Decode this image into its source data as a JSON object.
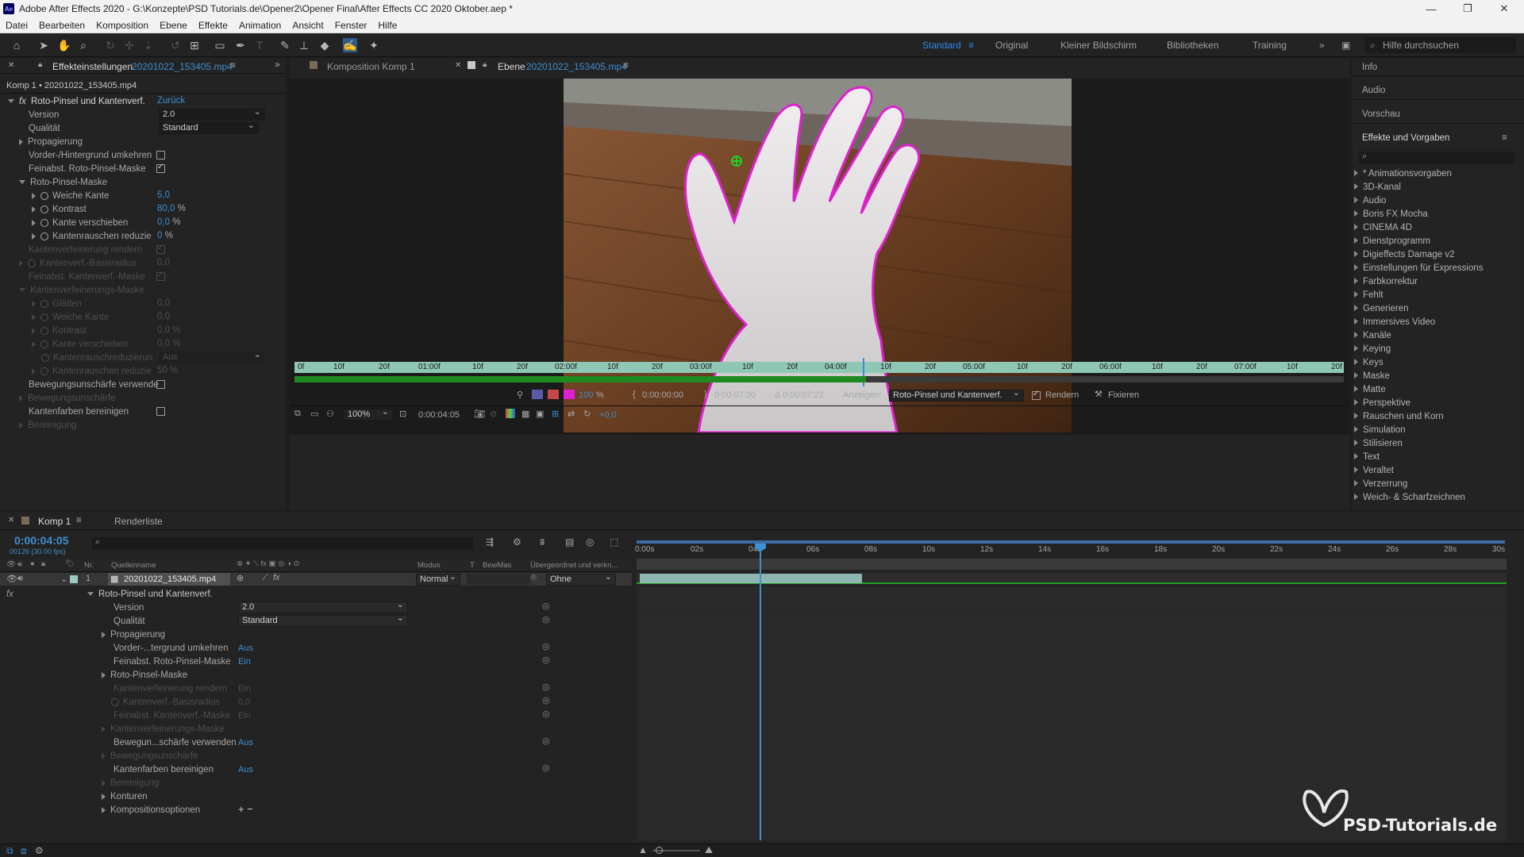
{
  "window": {
    "title": "Adobe After Effects 2020 - G:\\Konzepte\\PSD Tutorials.de\\Opener2\\Opener Final\\After Effects CC 2020 Oktober.aep *"
  },
  "menu": [
    "Datei",
    "Bearbeiten",
    "Komposition",
    "Ebene",
    "Effekte",
    "Animation",
    "Ansicht",
    "Fenster",
    "Hilfe"
  ],
  "workspaces": {
    "active": "Standard",
    "items": [
      "Original",
      "Kleiner Bildschirm",
      "Bibliotheken",
      "Training"
    ],
    "search_placeholder": "Hilfe durchsuchen"
  },
  "effect_panel": {
    "tab_label": "Effekteinstellungen",
    "tab_file": "20201022_153405.mp4",
    "breadcrumb": "Komp 1 • 20201022_153405.mp4",
    "effect_name": "Roto-Pinsel und Kantenverf.",
    "reset": "Zurück",
    "version_label": "Version",
    "version_value": "2.0",
    "quality_label": "Qualität",
    "quality_value": "Standard",
    "propagation": "Propagierung",
    "invert_fg": "Vorder-/Hintergrund umkehren",
    "fine_roto": "Feinabst. Roto-Pinsel-Maske",
    "roto_mask": "Roto-Pinsel-Maske",
    "soft_edge": "Weiche Kante",
    "soft_edge_value": "5,0",
    "contrast": "Kontrast",
    "contrast_value": "80,0",
    "contrast_unit": "%",
    "shift_edge": "Kante verschieben",
    "shift_edge_value": "0,0",
    "shift_edge_unit": "%",
    "edge_noise": "Kantenrauschen reduzie",
    "edge_noise_value": "0",
    "edge_noise_unit": "%",
    "refine_render": "Kantenverfeinerung rendern",
    "refine_radius": "Kantenverf.-Basisradius",
    "refine_radius_value": "0,0",
    "fine_refine": "Feinabst. Kantenverf.-Maske",
    "refine_mask": "Kantenverfeinerungs-Maske",
    "smooth": "Glätten",
    "smooth_value": "0,0",
    "soft_edge2": "Weiche Kante",
    "soft_edge2_value": "0,0",
    "contrast2": "Kontrast",
    "contrast2_value": "0,0 %",
    "shift_edge2": "Kante verschieben",
    "shift_edge2_value": "0,0 %",
    "edge_noise_reduce": "Kantenrauschreduzierun",
    "edge_noise_reduce_value": "Aus",
    "edge_noise2": "Kantenrauschen reduzie",
    "edge_noise2_value": "50 %",
    "motion_blur_use": "Bewegungsunschärfe verwende",
    "motion_blur": "Bewegungsunschärfe",
    "decontam": "Kantenfarben bereinigen",
    "cleanup": "Bereinigung"
  },
  "viewer": {
    "tab_comp": "Komposition  Komp 1",
    "tab_layer_label": "Ebene",
    "tab_layer_file": "20201022_153405.mp4",
    "ruler": [
      "0f",
      "10f",
      "20f",
      "01:00f",
      "10f",
      "20f",
      "02:00f",
      "10f",
      "20f",
      "03:00f",
      "10f",
      "20f",
      "04:00f",
      "10f",
      "20f",
      "05:00f",
      "10f",
      "20f",
      "06:00f",
      "10f",
      "20f",
      "07:00f",
      "10f",
      "20f"
    ],
    "opacity": "100",
    "opacity_unit": "%",
    "in_time": "0:00:00:00",
    "out_time": "0:00:07:20",
    "duration": "Δ 0:00:07:22",
    "show_label": "Anzeigen:",
    "show_value": "Roto-Pinsel und Kantenverf.",
    "render_label": "Rendern",
    "freeze_label": "Fixieren",
    "zoom": "100%",
    "current_time": "0:00:04:05",
    "exposure": "+0,0"
  },
  "right_panels": {
    "info": "Info",
    "audio": "Audio",
    "preview": "Vorschau",
    "effects_title": "Effekte und Vorgaben",
    "effects": [
      "* Animationsvorgaben",
      "3D-Kanal",
      "Audio",
      "Boris FX Mocha",
      "CINEMA 4D",
      "Dienstprogramm",
      "Digieffects Damage v2",
      "Einstellungen für Expressions",
      "Farbkorrektur",
      "Fehlt",
      "Generieren",
      "Immersives Video",
      "Kanäle",
      "Keying",
      "Keys",
      "Maske",
      "Matte",
      "Perspektive",
      "Rauschen und Korn",
      "Simulation",
      "Stilisieren",
      "Text",
      "Veraltet",
      "Verzerrung",
      "Weich- & Scharfzeichnen"
    ]
  },
  "timeline": {
    "tab": "Komp 1",
    "render_tab": "Renderliste",
    "timecode": "0:00:04:05",
    "fps": "00126 (30.00 fps)",
    "col_nr": "Nr.",
    "col_source": "Quellenname",
    "col_mode": "Modus",
    "col_t": "T",
    "col_trkmat": "BewMas",
    "col_parent": "Übergeordnet und verkn...",
    "layer_nr": "1",
    "layer_name": "20201022_153405.mp4",
    "layer_mode": "Normal",
    "layer_parent": "Ohne",
    "fx_label": "fx",
    "props": {
      "effect": "Roto-Pinsel und Kantenverf.",
      "version": "Version",
      "version_v": "2.0",
      "quality": "Qualität",
      "quality_v": "Standard",
      "propagation": "Propagierung",
      "invert": "Vorder-...tergrund umkehren",
      "invert_v": "Aus",
      "fine_roto": "Feinabst. Roto-Pinsel-Maske",
      "fine_roto_v": "Ein",
      "roto_mask": "Roto-Pinsel-Maske",
      "refine_render": "Kantenverfeinerung rendern",
      "refine_render_v": "Ein",
      "refine_radius": "Kantenverf.-Basisradius",
      "refine_radius_v": "0,0",
      "fine_refine": "Feinabst. Kantenverf.-Maske",
      "fine_refine_v": "Ein",
      "refine_mask": "Kantenverfeinerungs-Maske",
      "motion_use": "Bewegun...schärfe verwenden",
      "motion_use_v": "Aus",
      "motion": "Bewegungsunschärfe",
      "decontam": "Kantenfarben bereinigen",
      "decontam_v": "Aus",
      "cleanup": "Bereinigung",
      "contours": "Konturen",
      "comp_options": "Kompositionsoptionen",
      "plusminus": "+ −"
    },
    "ruler": [
      "0:00s",
      "02s",
      "04s",
      "06s",
      "08s",
      "10s",
      "12s",
      "14s",
      "16s",
      "18s",
      "20s",
      "22s",
      "24s",
      "26s",
      "28s",
      "30s"
    ]
  },
  "watermark": "PSD-Tutorials.de",
  "colors": {
    "accent": "#2d8ceb",
    "mask": "#e020d0",
    "layer_bar": "#8fb5b0"
  }
}
